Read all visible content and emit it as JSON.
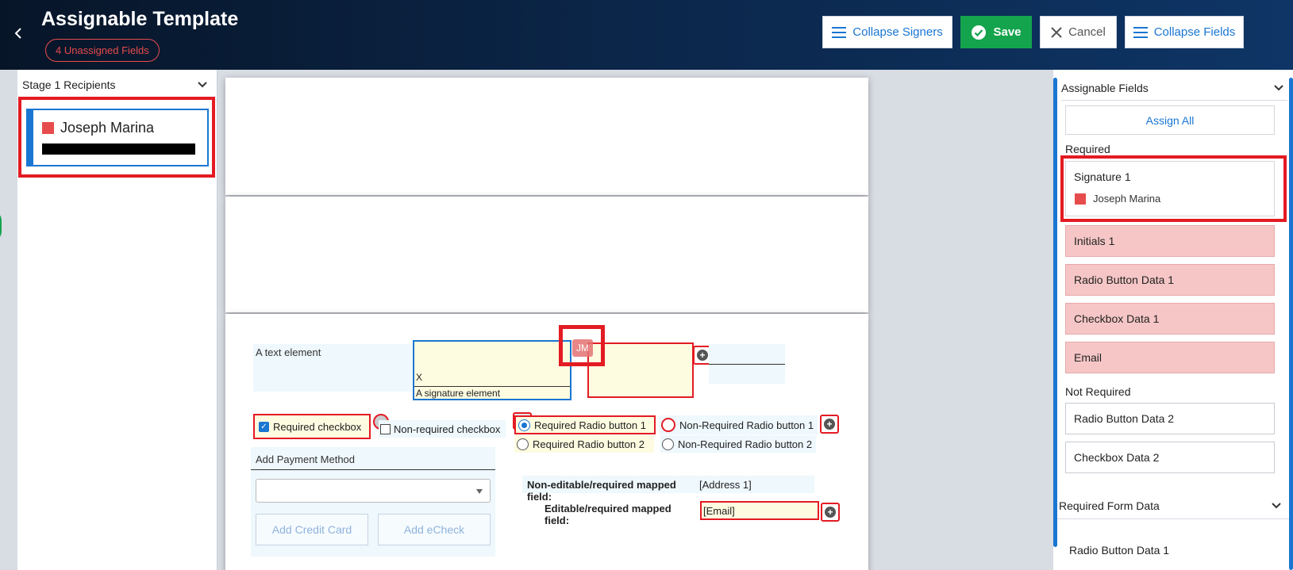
{
  "header": {
    "title": "Assignable Template",
    "badge": "4 Unassigned Fields",
    "buttons": {
      "collapse_signers": "Collapse Signers",
      "save": "Save",
      "cancel": "Cancel",
      "collapse_fields": "Collapse Fields"
    }
  },
  "left_panel": {
    "heading": "Stage 1 Recipients",
    "recipient": {
      "name": "Joseph Marina",
      "email_redacted": "redacted"
    }
  },
  "document": {
    "text_element": "A text element",
    "signature_x": "X",
    "signature_label": "A signature element",
    "signer_initials": "JM",
    "required_checkbox": "Required checkbox",
    "nonrequired_checkbox": "Non-required checkbox",
    "required_radio_1": "Required Radio button 1",
    "required_radio_2": "Required Radio button 2",
    "nonrequired_radio_1": "Non-Required Radio button 1",
    "nonrequired_radio_2": "Non-Required Radio button 2",
    "payment": {
      "title": "Add Payment Method",
      "add_credit_card": "Add Credit Card",
      "add_echeck": "Add eCheck"
    },
    "mapped": {
      "noneditable_label": "Non-editable/required mapped field:",
      "noneditable_value": "[Address 1]",
      "editable_label": "Editable/required mapped field:",
      "editable_value": "[Email]"
    }
  },
  "right_panel": {
    "heading": "Assignable Fields",
    "assign_all": "Assign All",
    "required_label": "Required",
    "signature_card": {
      "title": "Signature 1",
      "assignee": "Joseph Marina"
    },
    "required_fields": [
      "Initials 1",
      "Radio Button Data 1",
      "Checkbox Data 1",
      "Email"
    ],
    "not_required_label": "Not Required",
    "optional_fields": [
      "Radio Button Data 2",
      "Checkbox Data 2"
    ],
    "form_data_heading": "Required Form Data",
    "form_data_items": [
      "Radio Button Data 1"
    ]
  },
  "colors": {
    "accent": "#1976d2",
    "save": "#14a44d",
    "highlight": "#e31b23",
    "recipient": "#e74c4c",
    "required_card": "#f6c6c6"
  }
}
